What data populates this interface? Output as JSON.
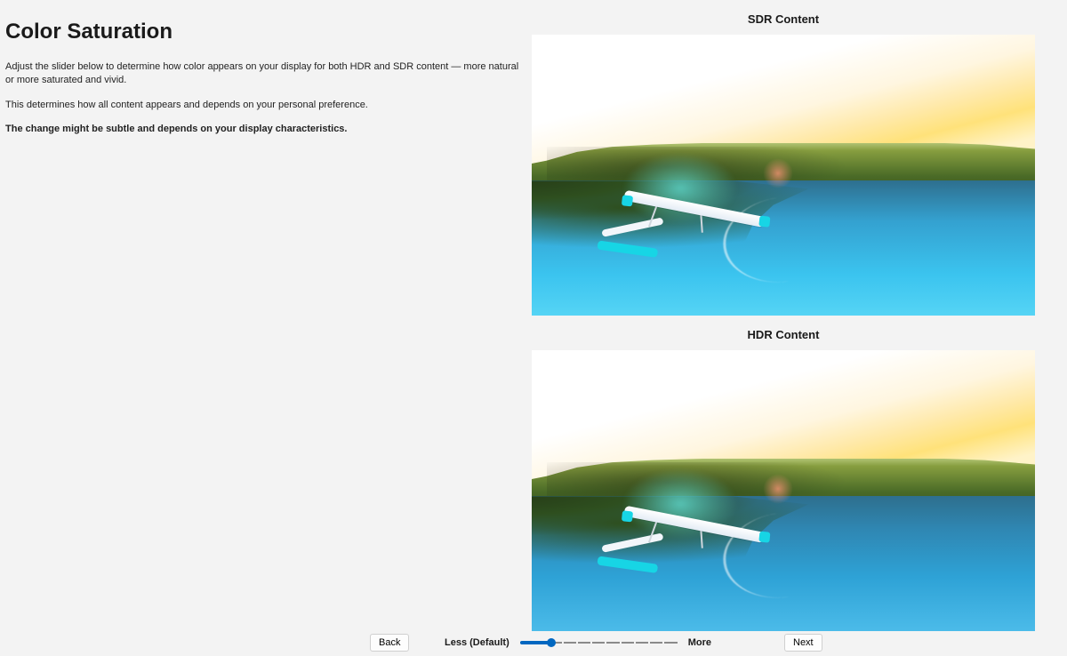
{
  "page": {
    "title": "Color Saturation",
    "paragraph1": "Adjust the slider below to determine how color appears on your display for both HDR and SDR content — more natural or more saturated and vivid.",
    "paragraph2": "This determines how all content appears and depends on your personal preference.",
    "paragraph3": "The change might be subtle and depends on your display characteristics."
  },
  "previews": {
    "sdr_label": "SDR Content",
    "hdr_label": "HDR Content"
  },
  "footer": {
    "back_label": "Back",
    "next_label": "Next",
    "slider_less_label": "Less (Default)",
    "slider_more_label": "More"
  },
  "slider": {
    "min": 0,
    "max": 100,
    "value": 20,
    "ticks": 11
  }
}
